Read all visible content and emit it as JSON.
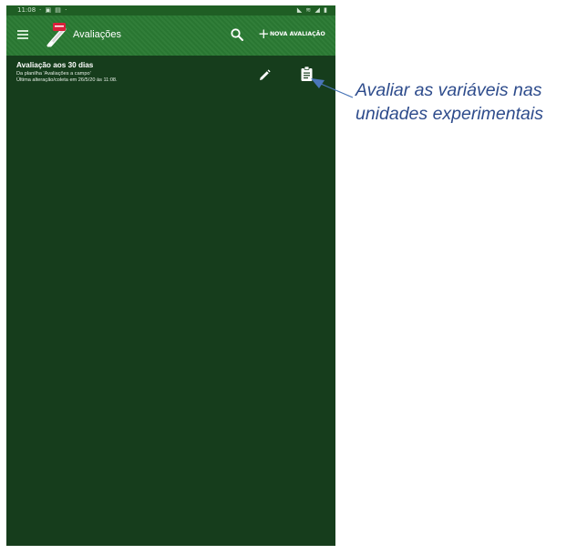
{
  "status_bar": {
    "time": "11:08",
    "notifications": "· ▣ ▤ ·",
    "system_icons": "◣ ≋ ◢ ▮"
  },
  "app_bar": {
    "title": "Avaliações",
    "menu_icon": "hamburger-menu-icon",
    "logo_icon": "app-logo-icon",
    "search_icon": "search-icon",
    "new_button_label": "NOVA AVALIAÇÃO",
    "new_button_glyph": "+"
  },
  "list": {
    "items": [
      {
        "title": "Avaliação aos 30 dias",
        "subtitle": "Da planilha 'Avaliações a campo'",
        "meta": "Última alteração/coleta em 26/5/20 às 11:08.",
        "edit_icon": "pencil-icon",
        "collect_icon": "clipboard-icon"
      }
    ]
  },
  "annotation": {
    "line1": "Avaliar as variáveis nas",
    "line2": "unidades experimentais"
  },
  "colors": {
    "app_bar": "#2a7a33",
    "background": "#163d1c",
    "annotation": "#2e4c8c",
    "arrow": "#4a76b8"
  }
}
